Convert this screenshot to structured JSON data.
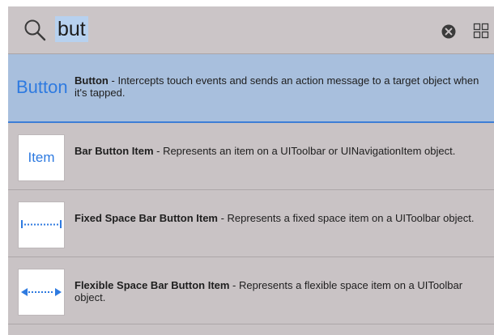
{
  "search": {
    "query": "but"
  },
  "icons": {
    "search": "search-icon",
    "clear": "clear-icon",
    "grid": "grid-view-icon"
  },
  "colors": {
    "accent": "#2e7ae0",
    "selection": "#a8bfdd",
    "panel": "#c9c3c5"
  },
  "results": [
    {
      "thumb": "Button",
      "title": "Button",
      "separator": " - ",
      "description": "Intercepts touch events and sends an action message to a target object when it's tapped."
    },
    {
      "thumb": "Item",
      "title": "Bar Button Item",
      "separator": " - ",
      "description": "Represents an item on a UIToolbar or UINavigationItem object."
    },
    {
      "thumb": "fixed-space-icon",
      "title": "Fixed Space Bar Button Item",
      "separator": " - ",
      "description": "Represents a fixed space item on a UIToolbar object."
    },
    {
      "thumb": "flexible-space-icon",
      "title": "Flexible Space Bar Button Item",
      "separator": " - ",
      "description": "Represents a flexible space item on a UIToolbar object."
    }
  ]
}
